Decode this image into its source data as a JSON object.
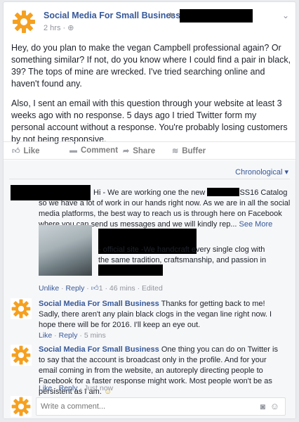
{
  "post": {
    "page_name": "Social Media For Small Business",
    "time": "2 hrs",
    "privacy_icon": "globe-icon",
    "paragraphs": [
      "Hey, do you plan to make the vegan Campbell professional again? Or something similar? If not, do you know where I could find a pair in black, 39? The tops of mine are wrecked. I've tried searching online and haven't found any.",
      "Also, I sent an email with this question through your website at least 3 weeks ago with no response. 5 days ago I tried Twitter form my personal account without a response. You're probably losing customers by not being responsive."
    ]
  },
  "actions": {
    "like": "Like",
    "comment": "Comment",
    "share": "Share",
    "buffer": "Buffer"
  },
  "comments_sort": "Chronological",
  "comments": [
    {
      "text_a": "Hi - We are working one the new ",
      "text_b": "SS16 Catalog so we have a lot of work in our hands right now. As we are in all the social media platforms, the best way to reach us is through here on Facebook where you can send us messages and we will kindly rep...",
      "see_more": "See More",
      "link_text": "- official site -We handcraft every single clog with the same tradition, craftsmanship, and passion in our...",
      "unlike": "Unlike",
      "reply": "Reply",
      "like_count": "1",
      "time": "46 mins",
      "edited": "Edited"
    },
    {
      "name": "Social Media For Small Business",
      "text": "Thanks for getting back to me! Sadly, there aren't any plain black clogs in the vegan line right now. I hope there will be for 2016. I'll keep an eye out.",
      "like": "Like",
      "reply": "Reply",
      "time": "5 mins"
    },
    {
      "name": "Social Media For Small Business",
      "text": "One thing you can do on Twitter is to say that the account is broadcast only in the profile. And for your email coming in from the website, an autoreply directing people to Facebook for a faster response might work. Most people won't be as persistent as I am.",
      "like": "Like",
      "reply": "Reply",
      "time": "Just now"
    }
  ],
  "composer": {
    "placeholder": "Write a comment..."
  },
  "colors": {
    "brand_orange": "#f7941d",
    "link_blue": "#365899"
  }
}
